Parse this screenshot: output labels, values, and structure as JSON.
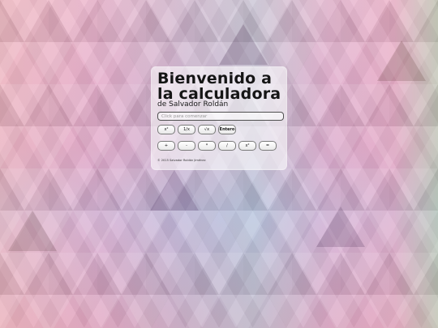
{
  "card": {
    "title": "Bienvenido a la calculadora",
    "subtitle": "de Salvador Roldán",
    "display": {
      "value": "",
      "placeholder": "Click para comenzar"
    },
    "function_buttons": [
      "x²",
      "1/x",
      "√x",
      "Entero"
    ],
    "operator_buttons": [
      "+",
      "-",
      "*",
      "/",
      "x²",
      "="
    ],
    "footer": "© 2015 Salvador Roldán Jiménez"
  },
  "colors": {
    "card_background": "#ffffffa0",
    "title_text": "#151515"
  }
}
